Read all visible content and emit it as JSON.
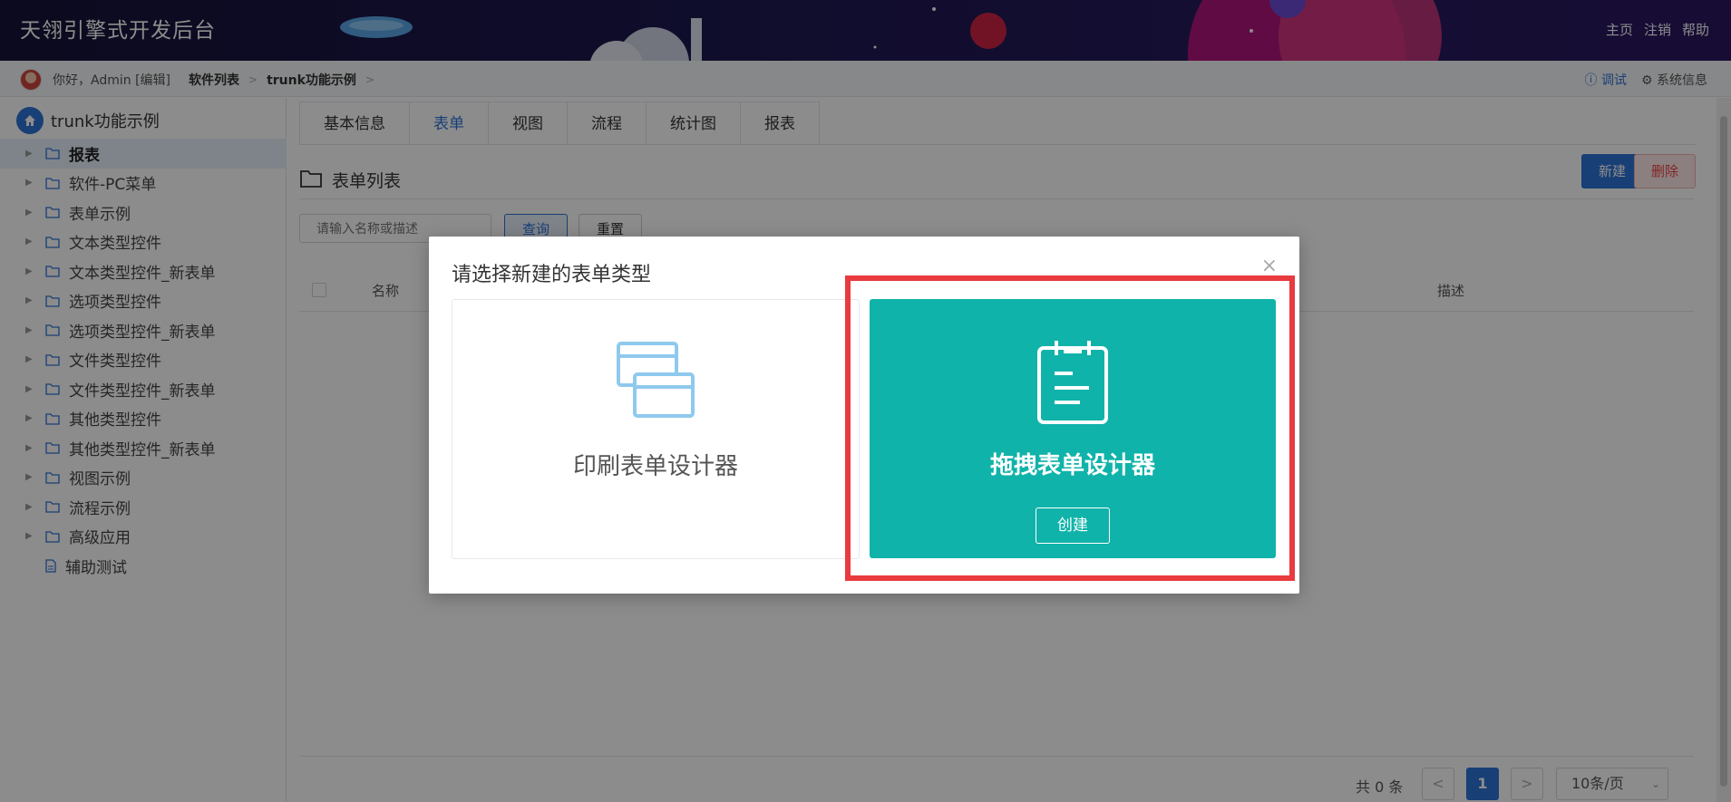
{
  "header": {
    "app_title": "天翎引擎式开发后台",
    "links": [
      "主页",
      "注销",
      "帮助"
    ]
  },
  "subbar": {
    "greeting": "你好，Admin [编辑]",
    "breadcrumbs": [
      "软件列表",
      "trunk功能示例"
    ],
    "debug_label": "调试",
    "sysinfo_label": "系统信息"
  },
  "sidebar": {
    "root_label": "trunk功能示例",
    "items": [
      {
        "label": "报表",
        "type": "folder",
        "active": true
      },
      {
        "label": "软件-PC菜单",
        "type": "folder"
      },
      {
        "label": "表单示例",
        "type": "folder"
      },
      {
        "label": "文本类型控件",
        "type": "folder"
      },
      {
        "label": "文本类型控件_新表单",
        "type": "folder"
      },
      {
        "label": "选项类型控件",
        "type": "folder"
      },
      {
        "label": "选项类型控件_新表单",
        "type": "folder"
      },
      {
        "label": "文件类型控件",
        "type": "folder"
      },
      {
        "label": "文件类型控件_新表单",
        "type": "folder"
      },
      {
        "label": "其他类型控件",
        "type": "folder"
      },
      {
        "label": "其他类型控件_新表单",
        "type": "folder"
      },
      {
        "label": "视图示例",
        "type": "folder"
      },
      {
        "label": "流程示例",
        "type": "folder"
      },
      {
        "label": "高级应用",
        "type": "folder"
      },
      {
        "label": "辅助测试",
        "type": "doc"
      }
    ]
  },
  "main": {
    "tabs": [
      {
        "label": "基本信息"
      },
      {
        "label": "表单",
        "active": true
      },
      {
        "label": "视图"
      },
      {
        "label": "流程"
      },
      {
        "label": "统计图"
      },
      {
        "label": "报表"
      }
    ],
    "list_title": "表单列表",
    "new_label": "新建",
    "delete_label": "删除",
    "search_placeholder": "请输入名称或描述",
    "query_label": "查询",
    "reset_label": "重置",
    "columns": {
      "name": "名称",
      "desc": "描述"
    },
    "pagination": {
      "total": "共 0 条",
      "current": "1",
      "page_size": "10条/页"
    }
  },
  "modal": {
    "title": "请选择新建的表单类型",
    "close": "×",
    "print_label": "印刷表单设计器",
    "drag_label": "拖拽表单设计器",
    "create_label": "创建"
  },
  "colors": {
    "accent": "#2d74d8",
    "teal_card": "#10b3a9",
    "highlight": "#e83a3f"
  }
}
